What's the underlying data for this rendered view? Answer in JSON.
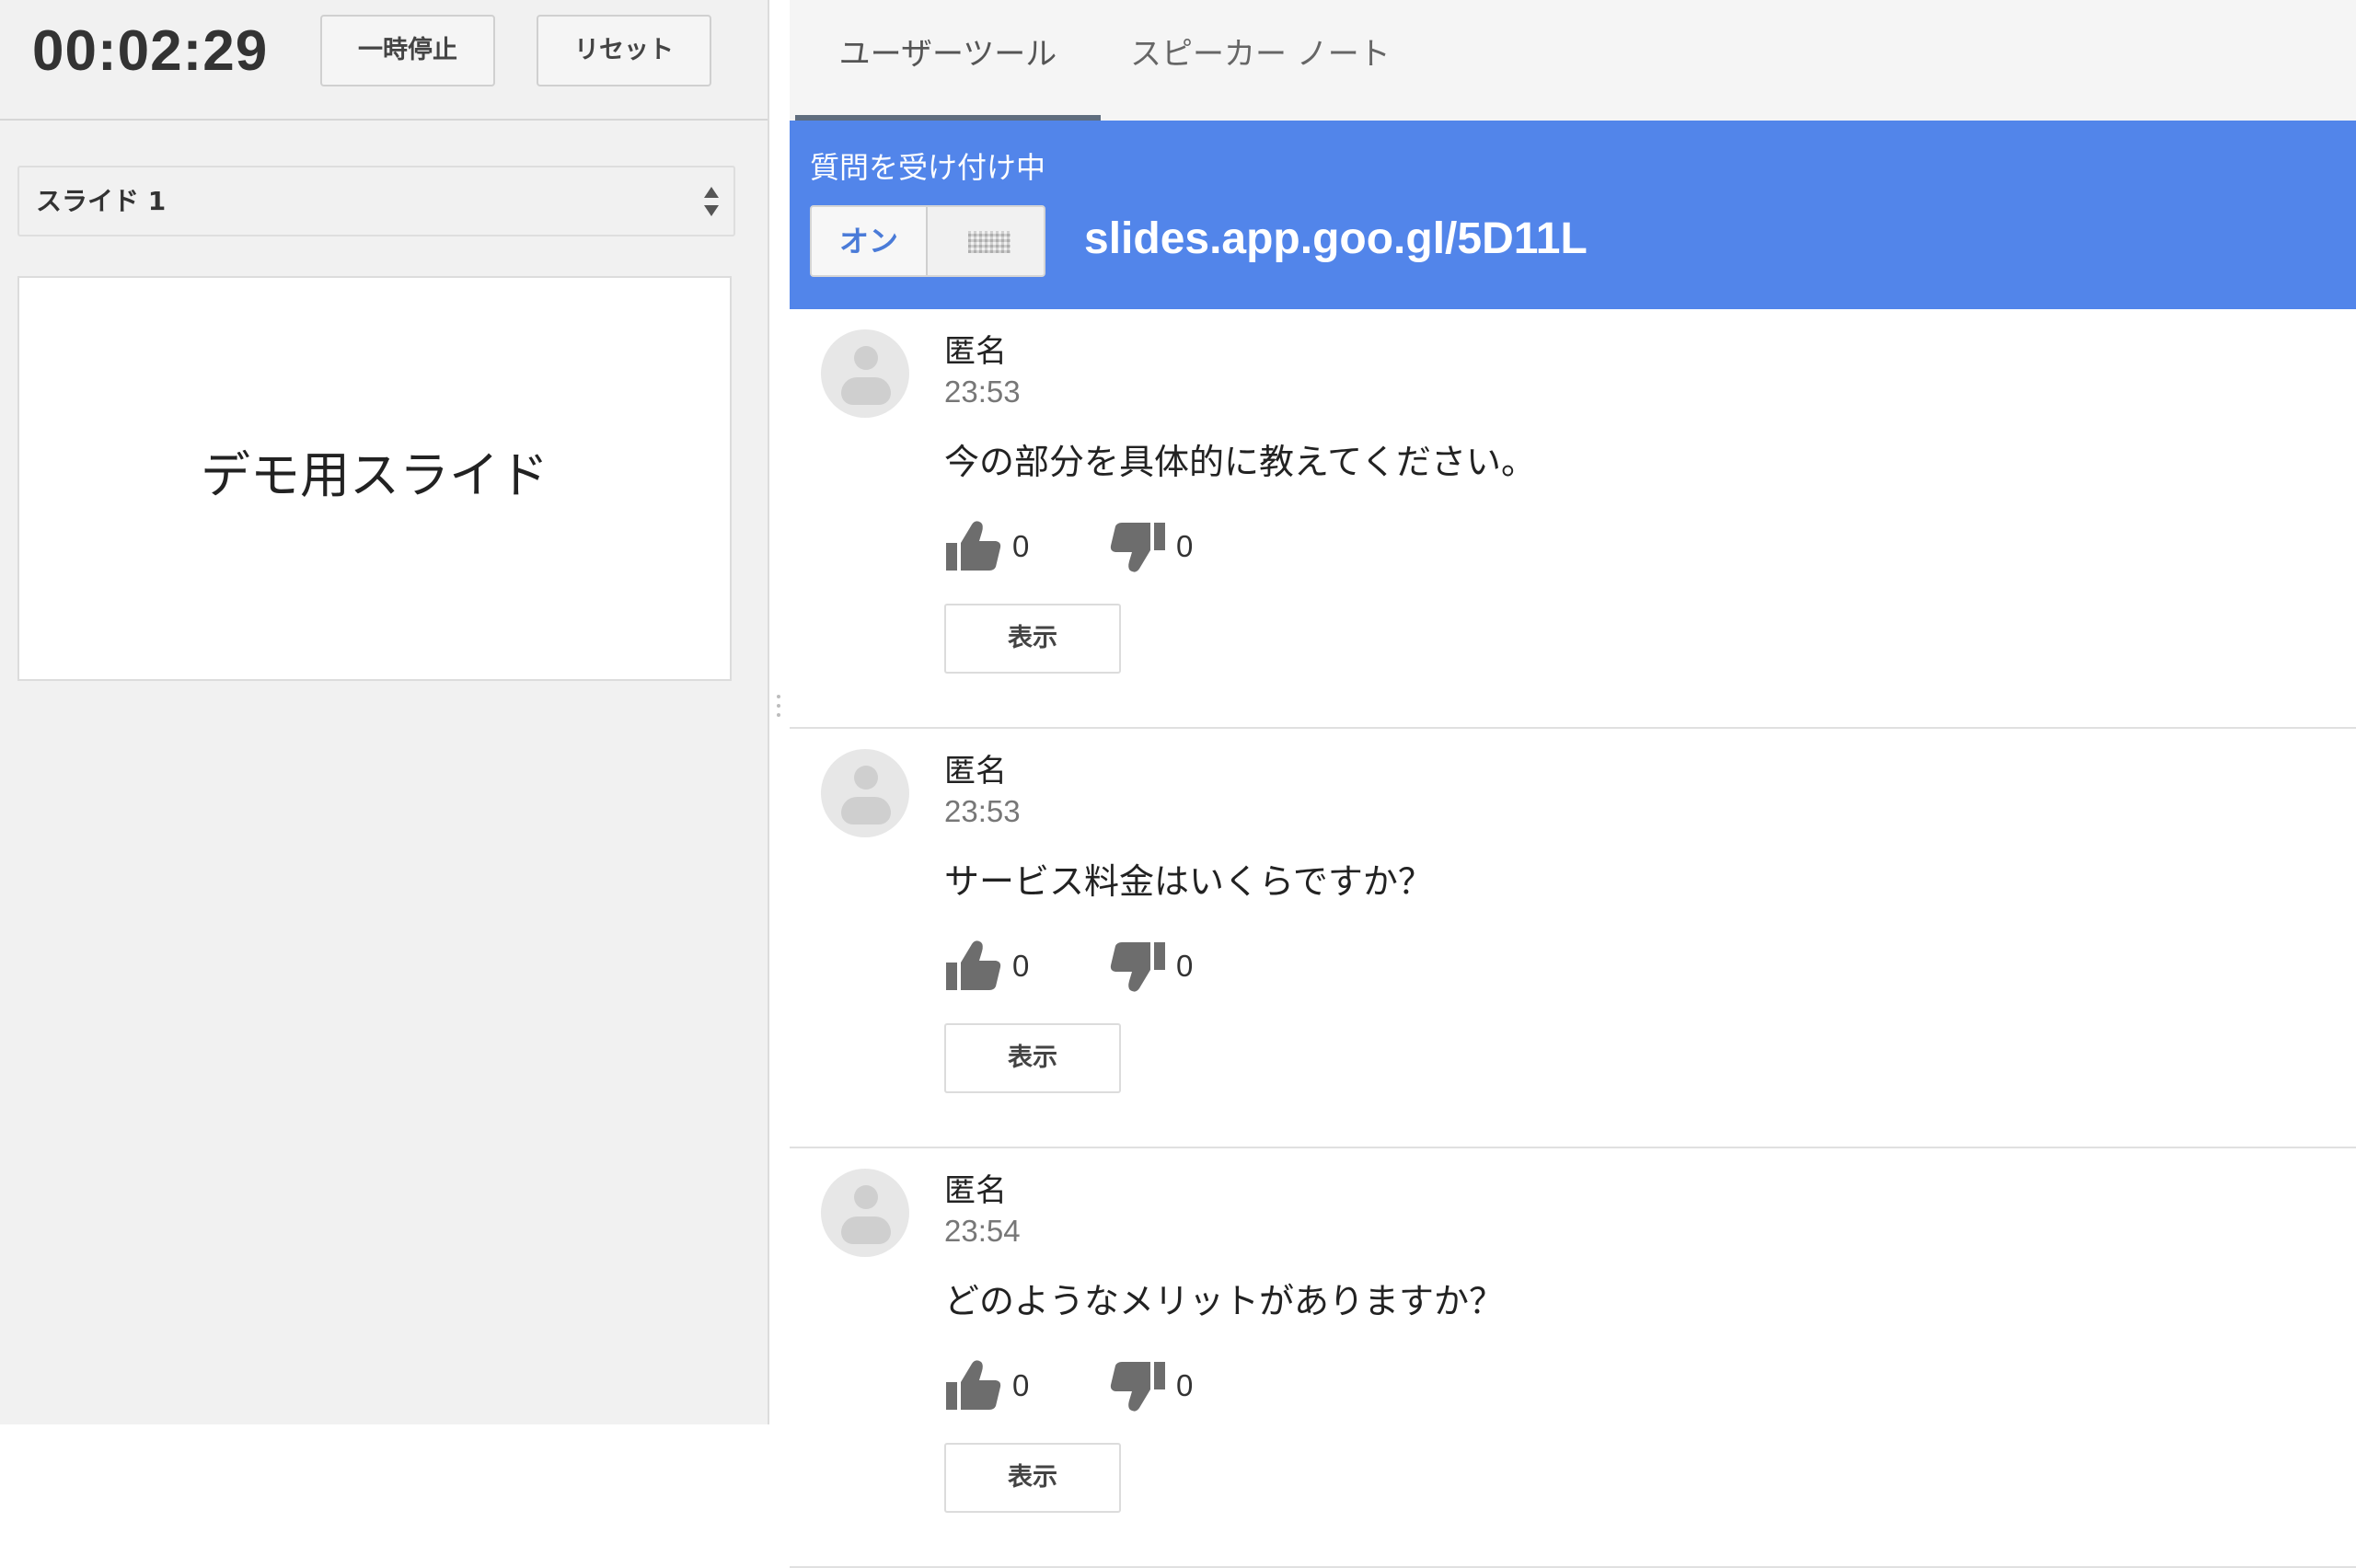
{
  "timer": {
    "display": "00:02:29"
  },
  "controls": {
    "pause_label": "一時停止",
    "reset_label": "リセット"
  },
  "slide_picker": {
    "selected": "スライド 1"
  },
  "slide_preview": {
    "title": "デモ用スライド"
  },
  "tabs": [
    {
      "label": "ユーザーツール",
      "active": true
    },
    {
      "label": "スピーカー ノート",
      "active": false
    }
  ],
  "qa": {
    "status": "質問を受け付け中",
    "toggle_label": "オン",
    "url": "slides.app.goo.gl/5D11L",
    "accent_color": "#5285ea"
  },
  "questions": [
    {
      "author": "匿名",
      "time": "23:53",
      "text": "今の部分を具体的に教えてください。",
      "upvotes": "0",
      "downvotes": "0",
      "show_label": "表示"
    },
    {
      "author": "匿名",
      "time": "23:53",
      "text": "サービス料金はいくらですか？",
      "upvotes": "0",
      "downvotes": "0",
      "show_label": "表示"
    },
    {
      "author": "匿名",
      "time": "23:54",
      "text": "どのようなメリットがありますか？",
      "upvotes": "0",
      "downvotes": "0",
      "show_label": "表示"
    }
  ]
}
